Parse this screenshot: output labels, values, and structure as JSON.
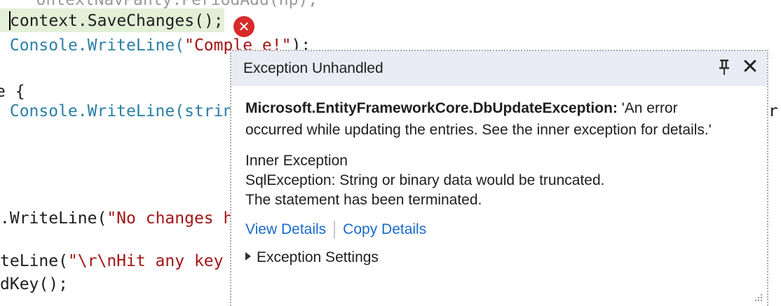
{
  "editor": {
    "cut_line": "   ontextNavPanty.PeriodAdd(np);",
    "line1_before": "",
    "line1": "context.SaveChanges();",
    "line2_indent": " ",
    "line2_method": "Console.WriteLine(",
    "line2_string": "\"Comple e!\"",
    "line2_end": ");",
    "line3": "e {",
    "line4_method": " Console.WriteLine(strin",
    "line4_right": "r",
    "line5_method": ".WriteLine(",
    "line5_string": "\"No changes h",
    "line6_method": "teLine(",
    "line6_string": "\"\\r\\nHit any key ",
    "line7": "dKey();"
  },
  "error_icon": "error-x-icon",
  "popup": {
    "title": "Exception Unhandled",
    "exception_type": "Microsoft.EntityFrameworkCore.DbUpdateException:",
    "exception_message": " 'An error occurred while updating the entries. See the inner exception for details.'",
    "inner_title": "Inner Exception",
    "inner_line1": "SqlException: String or binary data would be truncated.",
    "inner_line2": "The statement has been terminated.",
    "view_details": "View Details",
    "copy_details": "Copy Details",
    "settings_label": "Exception Settings"
  }
}
